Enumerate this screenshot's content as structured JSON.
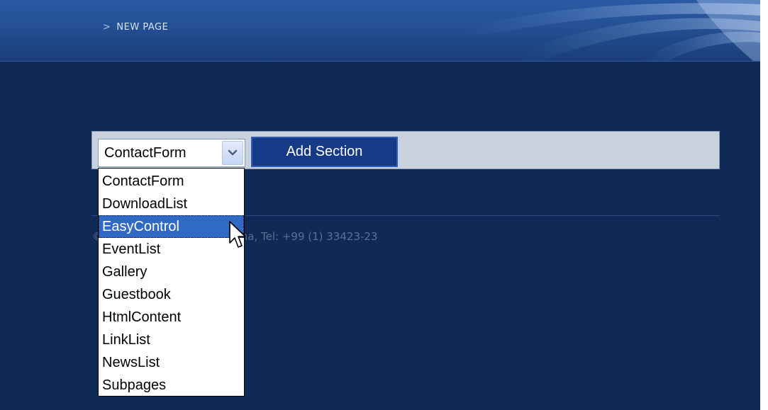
{
  "header": {
    "breadcrumb_arrow": ">",
    "breadcrumb_text": "NEW PAGE"
  },
  "toolbar": {
    "selected_value": "ContactForm",
    "add_section_label": "Add Section"
  },
  "dropdown": {
    "options": [
      "ContactForm",
      "DownloadList",
      "EasyControl",
      "EventList",
      "Gallery",
      "Guestbook",
      "HtmlContent",
      "LinkList",
      "NewsList",
      "Subpages"
    ],
    "highlighted_option": "EasyControl"
  },
  "footer": {
    "address_text": "©                ern Road 2, 2453 Maragona, Tel: +99 (1) 33423-23"
  },
  "colors": {
    "page_background": "#102a58",
    "header_blue": "#2b5aa4",
    "toolbar_bg": "#c9d1df",
    "button_bg": "#163a86",
    "selection_bg": "#316ac5"
  },
  "icons": {
    "select_arrow": "chevron-down-icon",
    "cursor": "mouse-pointer-icon"
  }
}
